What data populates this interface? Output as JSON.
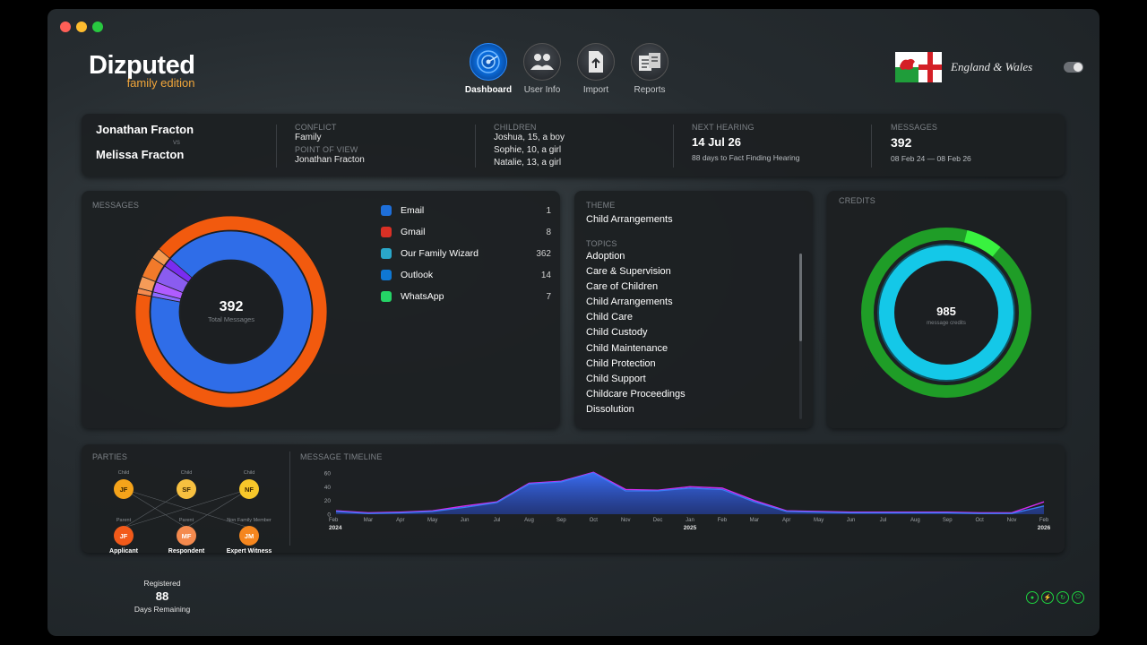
{
  "app": {
    "logo_main": "Dizputed",
    "logo_sub": "family edition",
    "jurisdiction": "England & Wales"
  },
  "nav": [
    {
      "label": "Dashboard",
      "icon": "dashboard-icon",
      "active": true
    },
    {
      "label": "User Info",
      "icon": "users-icon",
      "active": false
    },
    {
      "label": "Import",
      "icon": "import-icon",
      "active": false
    },
    {
      "label": "Reports",
      "icon": "reports-icon",
      "active": false
    }
  ],
  "summary": {
    "party1": "Jonathan Fracton",
    "vs": "vs",
    "party2": "Melissa Fracton",
    "conflict_label": "CONFLICT",
    "conflict": "Family",
    "pov_label": "POINT OF VIEW",
    "pov": "Jonathan Fracton",
    "children_label": "CHILDREN",
    "children": [
      "Joshua, 15, a boy",
      "Sophie, 10, a girl",
      "Natalie, 13, a girl"
    ],
    "hearing_label": "NEXT HEARING",
    "hearing_date": "14 Jul 26",
    "hearing_note": "88 days to Fact Finding Hearing",
    "messages_label": "MESSAGES",
    "messages_count": "392",
    "messages_range": "08 Feb 24 — 08 Feb 26"
  },
  "messages_panel": {
    "label": "MESSAGES",
    "total": "392",
    "total_label": "Total Messages",
    "sources": [
      {
        "name": "Email",
        "count": "1",
        "icon": "email-icon",
        "color": "#1e6fd9"
      },
      {
        "name": "Gmail",
        "count": "8",
        "icon": "gmail-icon",
        "color": "#d93025"
      },
      {
        "name": "Our Family Wizard",
        "count": "362",
        "icon": "ofw-icon",
        "color": "#2aa7c9"
      },
      {
        "name": "Outlook",
        "count": "14",
        "icon": "outlook-icon",
        "color": "#0f78d4"
      },
      {
        "name": "WhatsApp",
        "count": "7",
        "icon": "whatsapp-icon",
        "color": "#25d366"
      }
    ]
  },
  "topics_panel": {
    "theme_label": "THEME",
    "theme": "Child Arrangements",
    "topics_label": "TOPICS",
    "topics": [
      "Adoption",
      "Care & Supervision",
      "Care of Children",
      "Child Arrangements",
      "Child Care",
      "Child Custody",
      "Child Maintenance",
      "Child Protection",
      "Child Support",
      "Childcare Proceedings",
      "Dissolution"
    ]
  },
  "credits_panel": {
    "label": "CREDITS",
    "value": "985",
    "sub": "message credits",
    "used_fraction": 0.07
  },
  "parties_panel": {
    "label": "PARTIES",
    "top": [
      {
        "initials": "JF",
        "role": "Child"
      },
      {
        "initials": "SF",
        "role": "Child"
      },
      {
        "initials": "NF",
        "role": "Child"
      }
    ],
    "bottom": [
      {
        "initials": "JF",
        "role": "Parent",
        "label": "Applicant"
      },
      {
        "initials": "MF",
        "role": "Parent",
        "label": "Respondent"
      },
      {
        "initials": "JM",
        "role": "Non Family Member",
        "label": "Expert Witness"
      }
    ]
  },
  "chart_data": {
    "type": "area",
    "title": "MESSAGE TIMELINE",
    "ylim": [
      0,
      60
    ],
    "yticks": [
      "0",
      "20",
      "40",
      "60"
    ],
    "x": [
      "Feb",
      "Mar",
      "Apr",
      "May",
      "Jun",
      "Jul",
      "Aug",
      "Sep",
      "Oct",
      "Nov",
      "Dec",
      "Jan",
      "Feb",
      "Mar",
      "Apr",
      "May",
      "Jun",
      "Jul",
      "Aug",
      "Sep",
      "Oct",
      "Nov",
      "Feb"
    ],
    "year_labels": [
      {
        "label": "2024",
        "index": 0
      },
      {
        "label": "2025",
        "index": 11
      },
      {
        "label": "2026",
        "index": 22
      }
    ],
    "series": [
      {
        "values": [
          5,
          2,
          3,
          5,
          12,
          18,
          45,
          48,
          61,
          36,
          35,
          40,
          38,
          20,
          5,
          4,
          3,
          3,
          3,
          3,
          2,
          2,
          18
        ]
      },
      {
        "values": [
          4,
          1,
          2,
          4,
          10,
          17,
          44,
          47,
          60,
          34,
          34,
          38,
          36,
          18,
          4,
          3,
          2,
          2,
          2,
          2,
          1,
          1,
          12
        ]
      }
    ]
  },
  "footer": {
    "registered": "Registered",
    "days": "88",
    "days_label": "Days Remaining"
  }
}
